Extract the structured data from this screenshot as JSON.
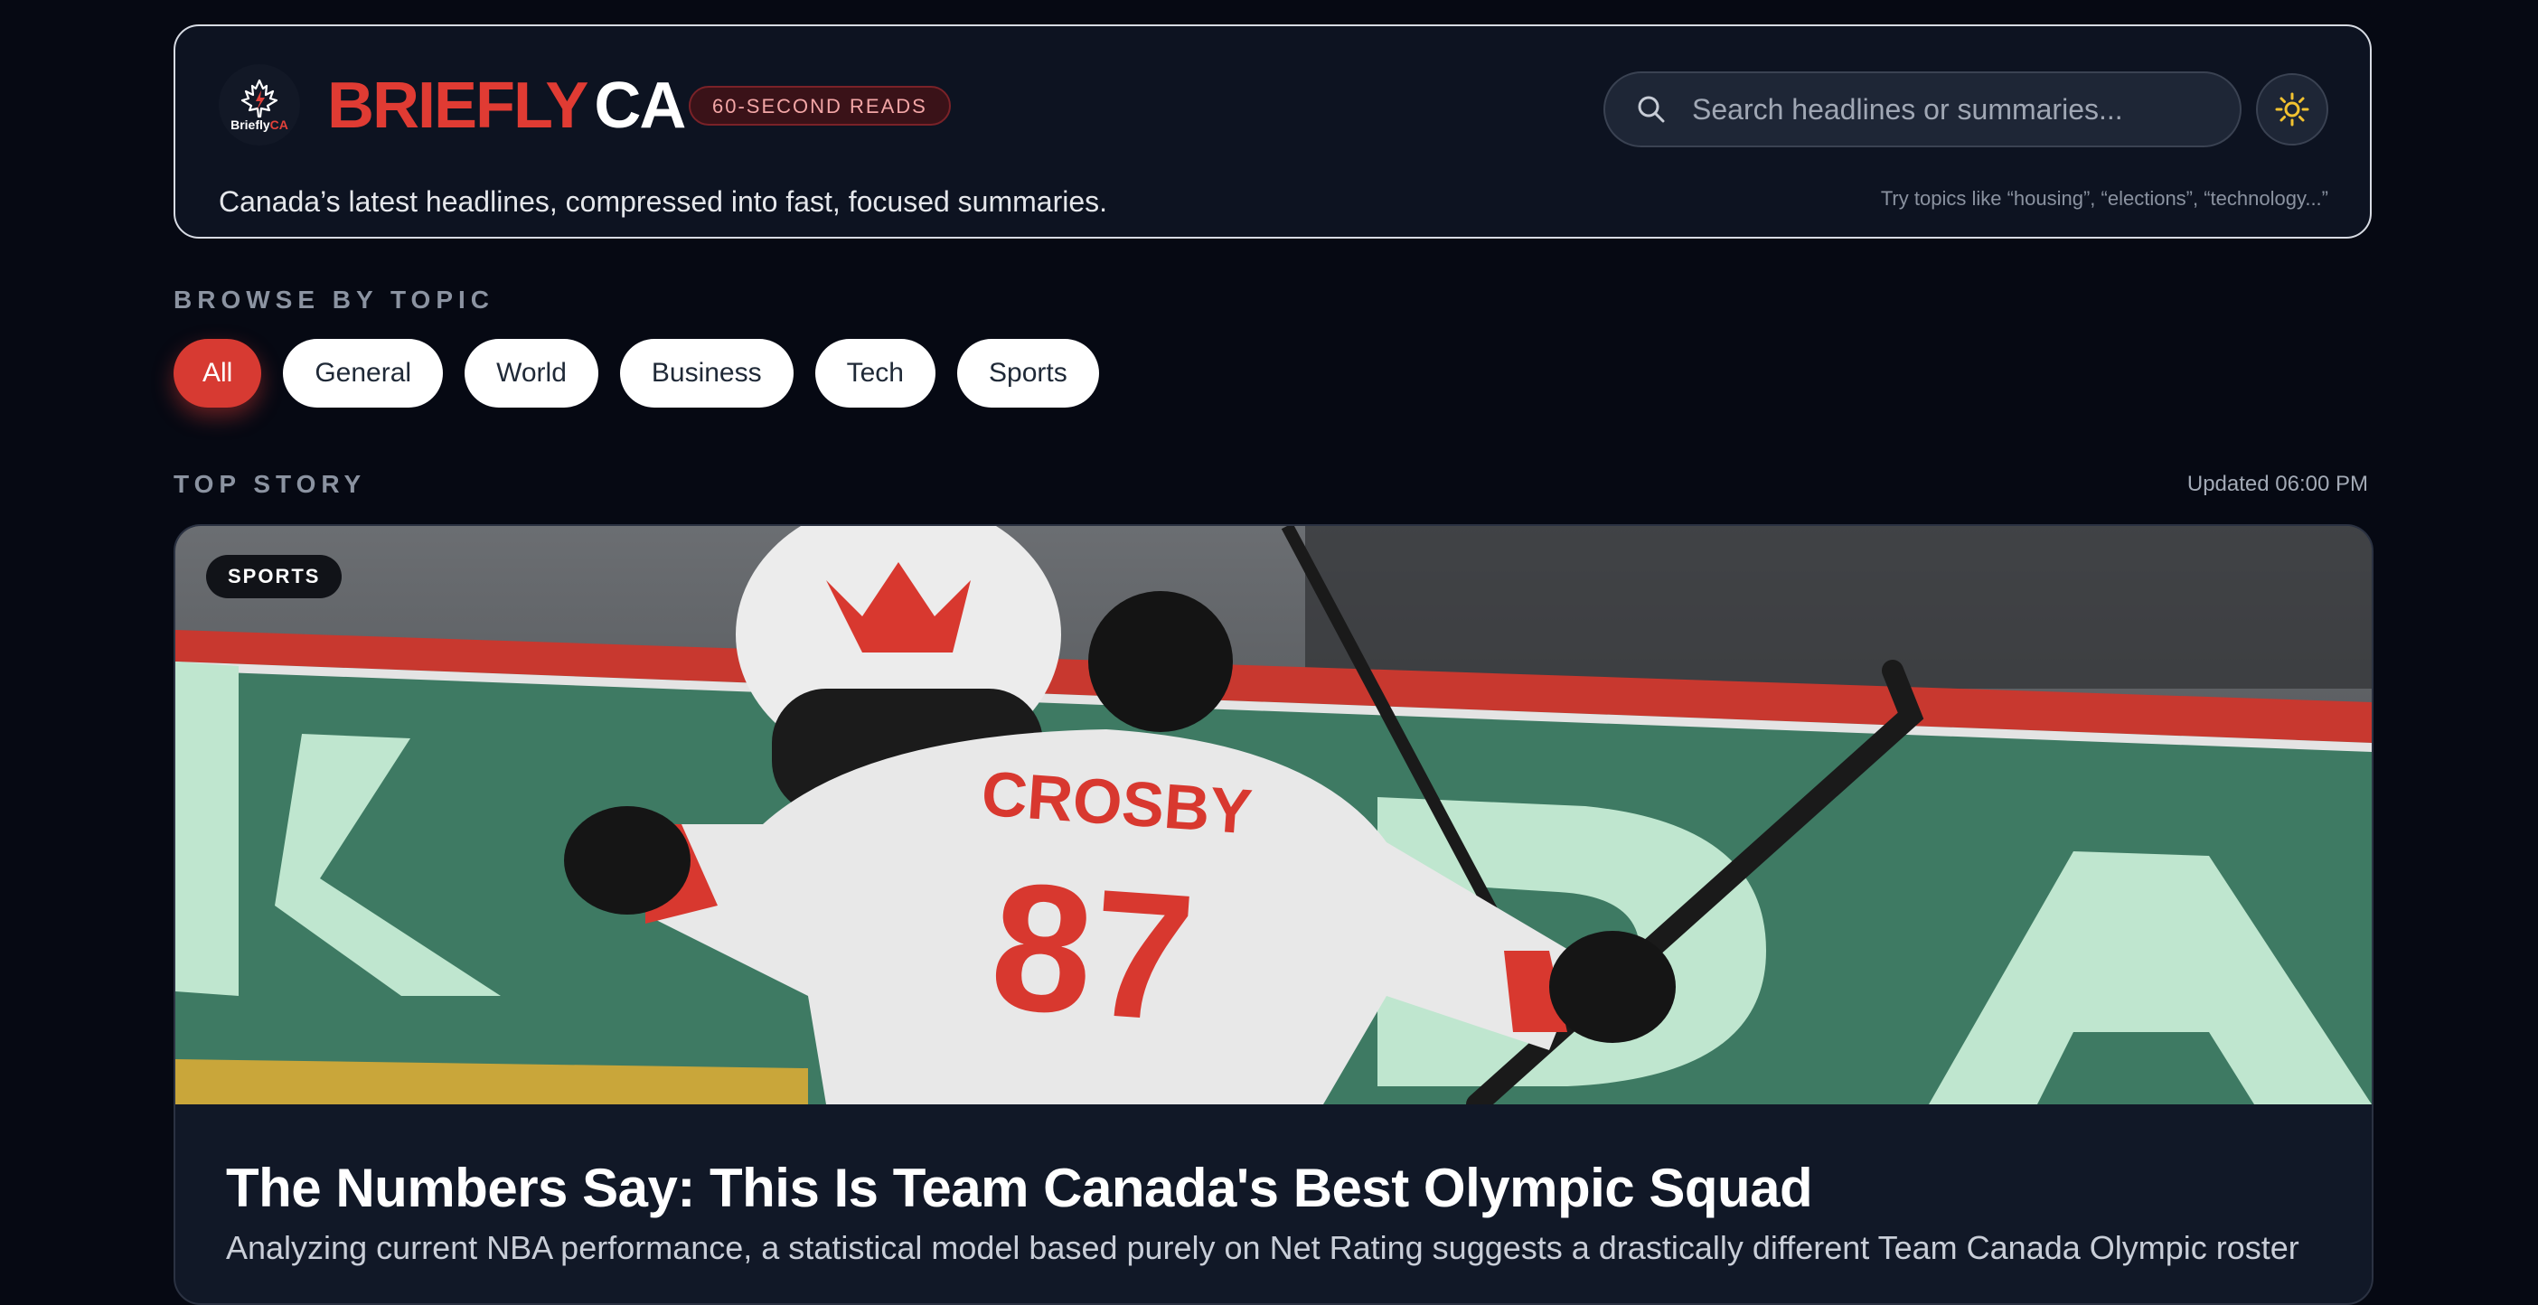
{
  "header": {
    "logo_text_main": "Briefly",
    "logo_text_accent": "CA",
    "brand_red": "BRIEFLY",
    "brand_white": "CA",
    "badge": "60-SECOND READS",
    "tagline": "Canada’s latest headlines, compressed into fast, focused summaries.",
    "search_placeholder": "Search headlines or summaries...",
    "search_hint": "Try topics like “housing”, “elections”, “technology...”",
    "theme_icon": "sun-icon"
  },
  "topics": {
    "label": "BROWSE BY TOPIC",
    "items": [
      "All",
      "General",
      "World",
      "Business",
      "Tech",
      "Sports"
    ],
    "active": "All"
  },
  "top_story": {
    "label": "TOP STORY",
    "updated": "Updated 06:00 PM",
    "tag": "SPORTS",
    "title": "The Numbers Say: This Is Team Canada's Best Olympic Squad",
    "summary": "Analyzing current NBA performance, a statistical model based purely on Net Rating suggests a drastically different Team Canada Olympic roster",
    "image_jersey_name": "CROSBY",
    "image_jersey_number": "87"
  },
  "colors": {
    "background": "#060913",
    "accent_red": "#d73a32",
    "card": "#0d1321"
  }
}
